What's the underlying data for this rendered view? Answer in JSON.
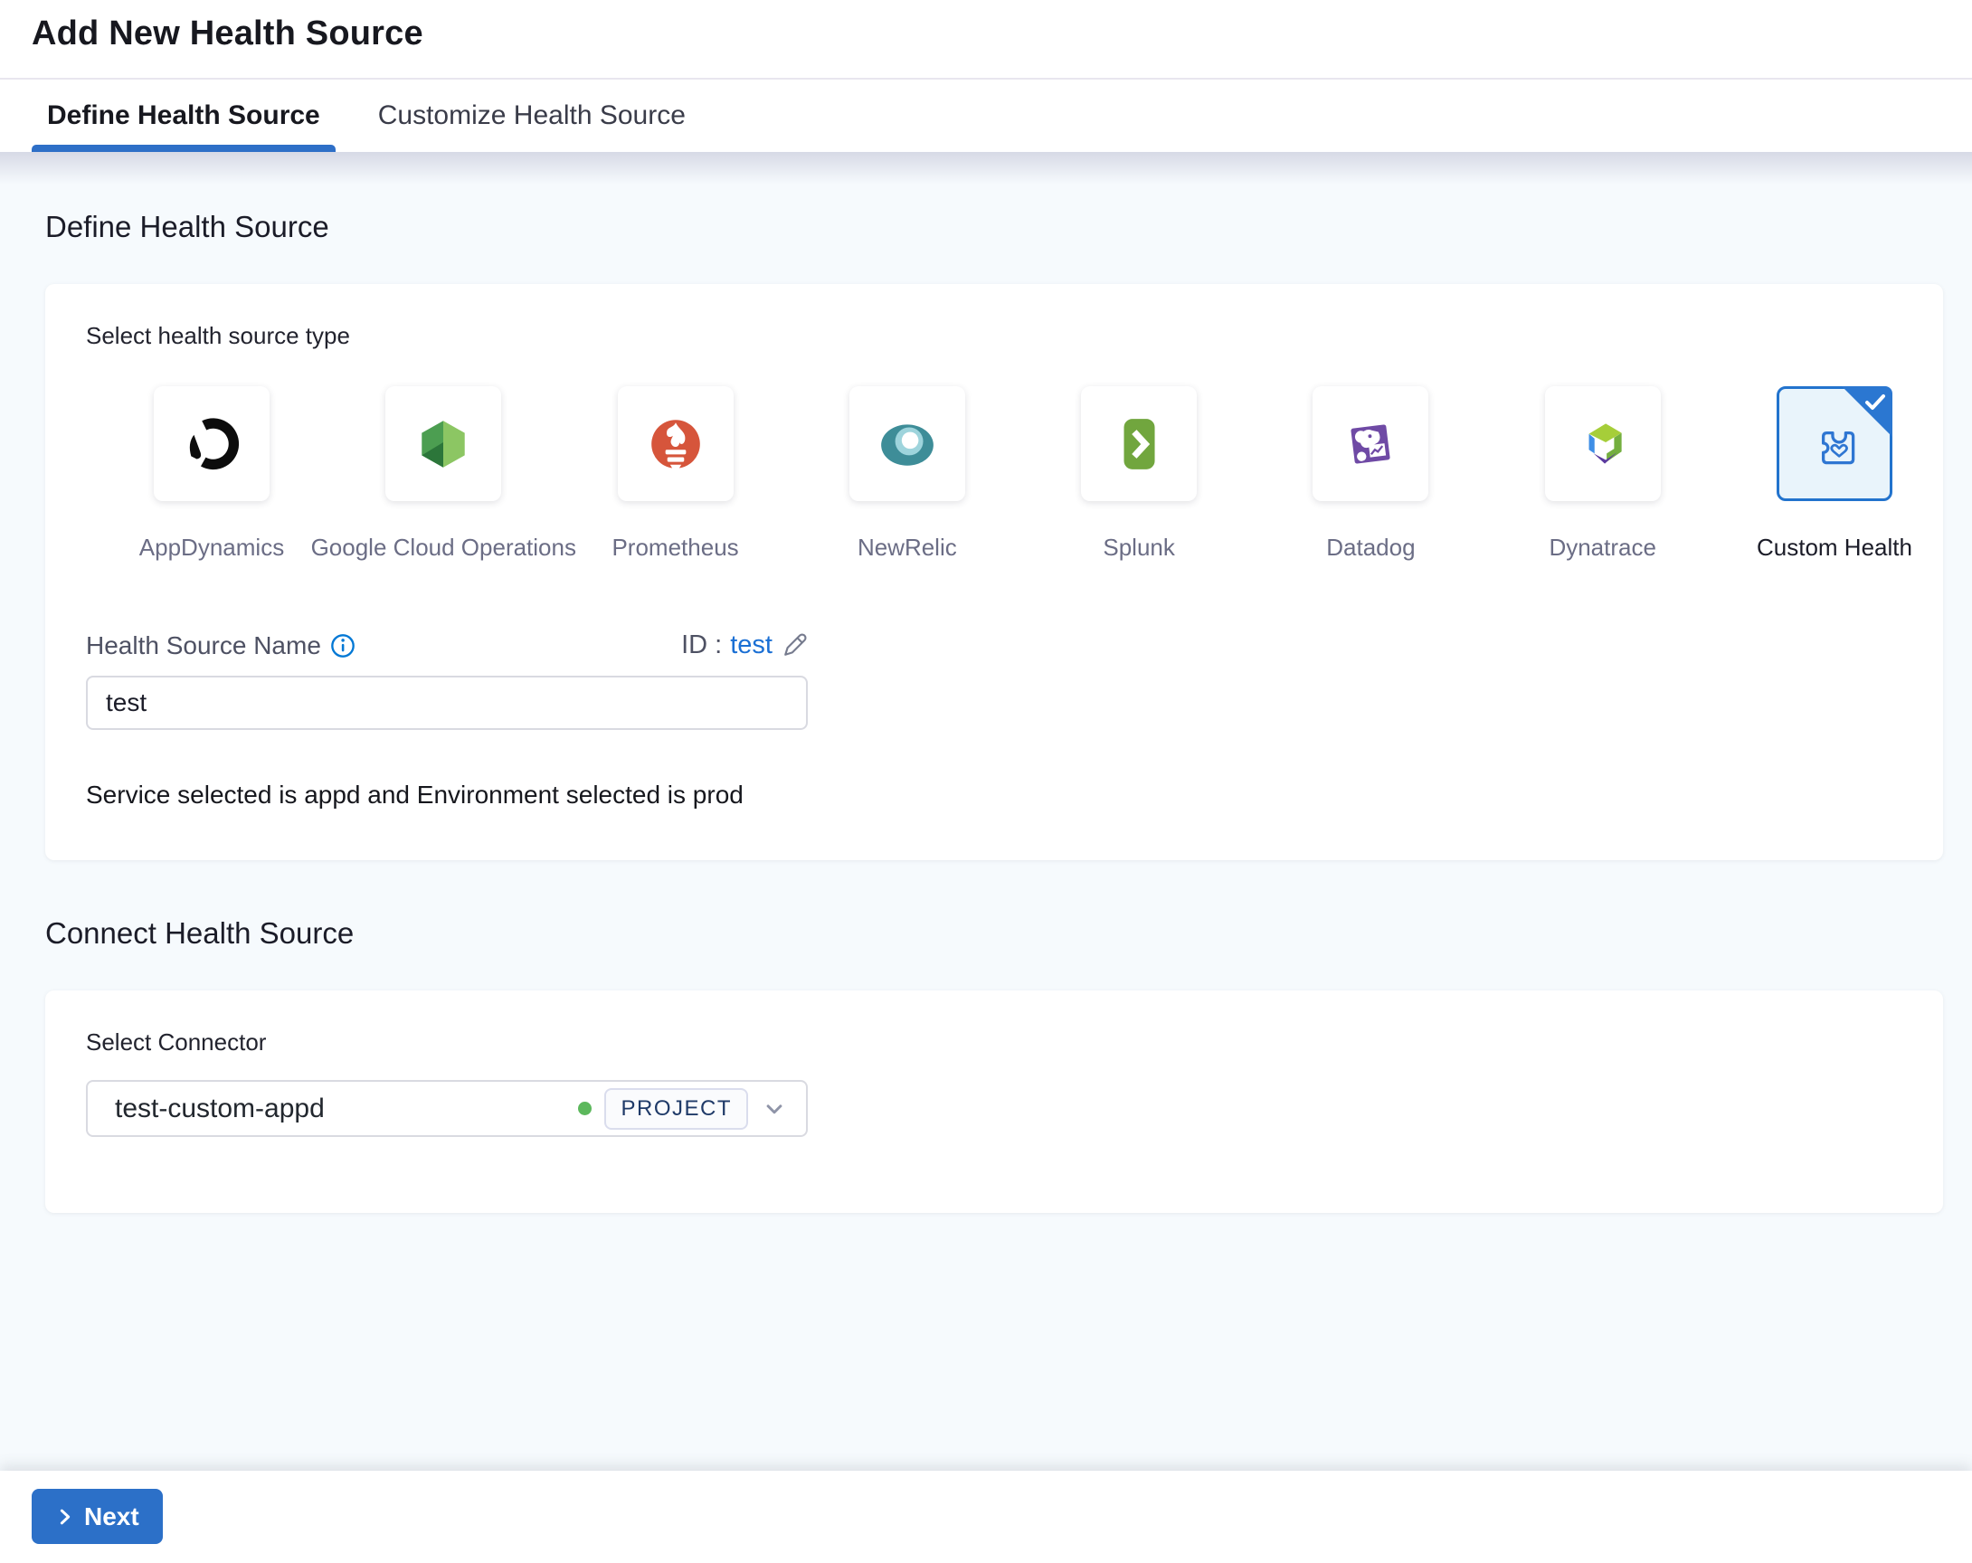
{
  "header": {
    "title": "Add New Health Source",
    "tabs": [
      {
        "label": "Define Health Source",
        "active": true
      },
      {
        "label": "Customize Health Source",
        "active": false
      }
    ]
  },
  "define_section": {
    "heading": "Define Health Source",
    "select_type_label": "Select health source type",
    "source_types": [
      {
        "label": "AppDynamics",
        "icon": "appdynamics-icon",
        "selected": false
      },
      {
        "label": "Google Cloud Operations",
        "icon": "google-cloud-operations-icon",
        "selected": false
      },
      {
        "label": "Prometheus",
        "icon": "prometheus-icon",
        "selected": false
      },
      {
        "label": "NewRelic",
        "icon": "newrelic-icon",
        "selected": false
      },
      {
        "label": "Splunk",
        "icon": "splunk-icon",
        "selected": false
      },
      {
        "label": "Datadog",
        "icon": "datadog-icon",
        "selected": false
      },
      {
        "label": "Dynatrace",
        "icon": "dynatrace-icon",
        "selected": false
      },
      {
        "label": "Custom Health",
        "icon": "custom-health-icon",
        "selected": true
      }
    ],
    "name_field": {
      "label": "Health Source Name",
      "id_label": "ID :",
      "id_value": "test",
      "value": "test"
    },
    "service_env_text": "Service selected is appd and Environment selected is prod"
  },
  "connect_section": {
    "heading": "Connect Health Source",
    "connector_label": "Select Connector",
    "connector": {
      "value": "test-custom-appd",
      "scope_badge": "PROJECT",
      "status": "connected"
    }
  },
  "footer": {
    "next_label": "Next"
  },
  "colors": {
    "primary_blue": "#2c70c8",
    "tab_underline_blue": "#2e6fc7",
    "link_blue": "#1a6fd4",
    "selected_tile_bg": "#e9f4fb",
    "selected_tile_border": "#2273cd",
    "status_green": "#5cb85c",
    "tile_label_gray": "#6b6d85",
    "content_bg": "#f6fafd"
  }
}
